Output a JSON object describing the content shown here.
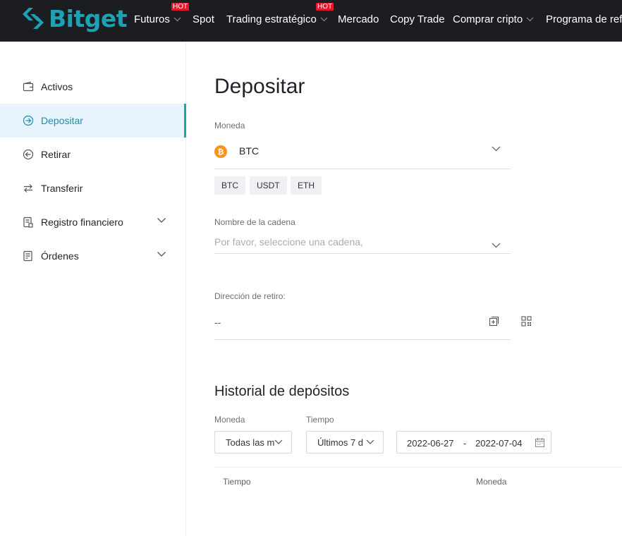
{
  "brand": {
    "name": "Bitget",
    "color": "#1da2b4"
  },
  "nav": {
    "items": [
      {
        "label": "Futuros",
        "hot": true,
        "dropdown": true
      },
      {
        "label": "Spot",
        "hot": false,
        "dropdown": false
      },
      {
        "label": "Trading estratégico",
        "hot": true,
        "dropdown": true
      },
      {
        "label": "Mercado",
        "hot": false,
        "dropdown": false
      },
      {
        "label": "Copy Trade",
        "hot": false,
        "dropdown": false
      },
      {
        "label": "Comprar cripto",
        "hot": false,
        "dropdown": true
      },
      {
        "label": "Programa de refe",
        "hot": false,
        "dropdown": false
      }
    ],
    "hot_label": "HOT"
  },
  "sidebar": {
    "items": [
      {
        "label": "Activos",
        "icon": "wallet-icon",
        "active": false,
        "expandable": false
      },
      {
        "label": "Depositar",
        "icon": "deposit-icon",
        "active": true,
        "expandable": false
      },
      {
        "label": "Retirar",
        "icon": "withdraw-icon",
        "active": false,
        "expandable": false
      },
      {
        "label": "Transferir",
        "icon": "transfer-icon",
        "active": false,
        "expandable": false
      },
      {
        "label": "Registro financiero",
        "icon": "ledger-icon",
        "active": false,
        "expandable": true
      },
      {
        "label": "Órdenes",
        "icon": "orders-icon",
        "active": false,
        "expandable": true
      }
    ]
  },
  "deposit": {
    "title": "Depositar",
    "coin_label": "Moneda",
    "coin_value": "BTC",
    "coin_icon": "bitcoin-icon",
    "quick_coins": [
      "BTC",
      "USDT",
      "ETH"
    ],
    "chain_label": "Nombre de la cadena",
    "chain_placeholder": "Por favor, seleccione una cadena,",
    "address_label": "Dirección de retiro:",
    "address_value": "--"
  },
  "history": {
    "title": "Historial de depósitos",
    "coin_filter_label": "Moneda",
    "coin_filter_value": "Todas las m",
    "time_filter_label": "Tiempo",
    "time_filter_value": "Últimos 7 d",
    "date_from": "2022-06-27",
    "date_sep": "-",
    "date_to": "2022-07-04",
    "columns": [
      "Tiempo",
      "Moneda"
    ]
  },
  "colors": {
    "accent": "#1da2b4",
    "active_bg": "#e7f3fd",
    "hot": "#e5172c",
    "btc": "#f7931a",
    "nav_bg": "#1b1d21"
  }
}
